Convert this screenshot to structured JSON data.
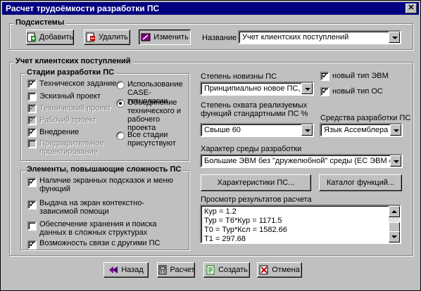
{
  "window": {
    "title": "Расчет трудоёмкости разработки ПС",
    "close_glyph": "✕"
  },
  "subsystems": {
    "group_label": "Подсистемы",
    "add_label": "Добавить",
    "delete_label": "Удалить",
    "edit_label": "Изменить",
    "name_label": "Название",
    "name_value": "Учет клиентских поступлений"
  },
  "main_group_label": "Учет клиентских поступлений",
  "stages": {
    "group_label": "Стадии разработки ПС",
    "items": [
      {
        "label": "Техническое задание",
        "checked": true,
        "disabled": false
      },
      {
        "label": "Эскизный проект",
        "checked": false,
        "disabled": false
      },
      {
        "label": "Технический проект",
        "checked": true,
        "disabled": true
      },
      {
        "label": "Рабочий проект",
        "checked": true,
        "disabled": true
      },
      {
        "label": "Внедрение",
        "checked": true,
        "disabled": false
      },
      {
        "label": "Предварительное проектирование",
        "checked": false,
        "disabled": true
      }
    ],
    "radios": [
      {
        "label": "Использование CASE-технологии",
        "selected": false
      },
      {
        "label": "Объединение технического и рабочего проекта",
        "selected": true
      },
      {
        "label": "Все стадии присутствуют",
        "selected": false
      }
    ]
  },
  "complexity": {
    "group_label": "Элементы, повышающие сложность ПС",
    "items": [
      {
        "label": "Наличие экранных подсказок и меню функций",
        "checked": true
      },
      {
        "label": "Выдача на экран контекстно-зависимой помощи",
        "checked": true
      },
      {
        "label": "Обеспечение хранения и поиска данных в сложных структурах",
        "checked": false
      },
      {
        "label": "Возможность связи с другими ПС",
        "checked": true
      }
    ]
  },
  "novelty": {
    "label": "Степень новизны  ПС",
    "value": "Принципиально новое ПС, не"
  },
  "new_evm": {
    "label": "новый тип ЭВМ",
    "checked": true
  },
  "new_os": {
    "label": "новый тип ОС",
    "checked": true
  },
  "coverage": {
    "label": "Степень охвата реализуемых функций стандартными ПС %",
    "value": "Свыше 60"
  },
  "tools": {
    "label": "Средства разработки ПС",
    "value": "Язык Ассемблера"
  },
  "environment": {
    "label": "Характер среды разработки",
    "value": "Большие ЭВМ без \"дружелюбной\" среды  (ЕС ЭВМ с ОС"
  },
  "characteristics_button": "Характеристики ПС...",
  "catalog_button": "Каталог функций...",
  "results": {
    "label": "Просмотр результатов расчета",
    "lines": [
      "Кур = 1.2",
      "Тур = Т6*Кур = 1171.5",
      "Т0 = Тур*Ксл = 1582.66",
      "Т1 = 297.68"
    ]
  },
  "footer": {
    "back": "Назад",
    "calc": "Расчет",
    "create": "Создать",
    "cancel": "Отмена"
  },
  "colors": {
    "title_bar": "#000080",
    "face": "#c0c0c0",
    "field": "#ffffff"
  }
}
